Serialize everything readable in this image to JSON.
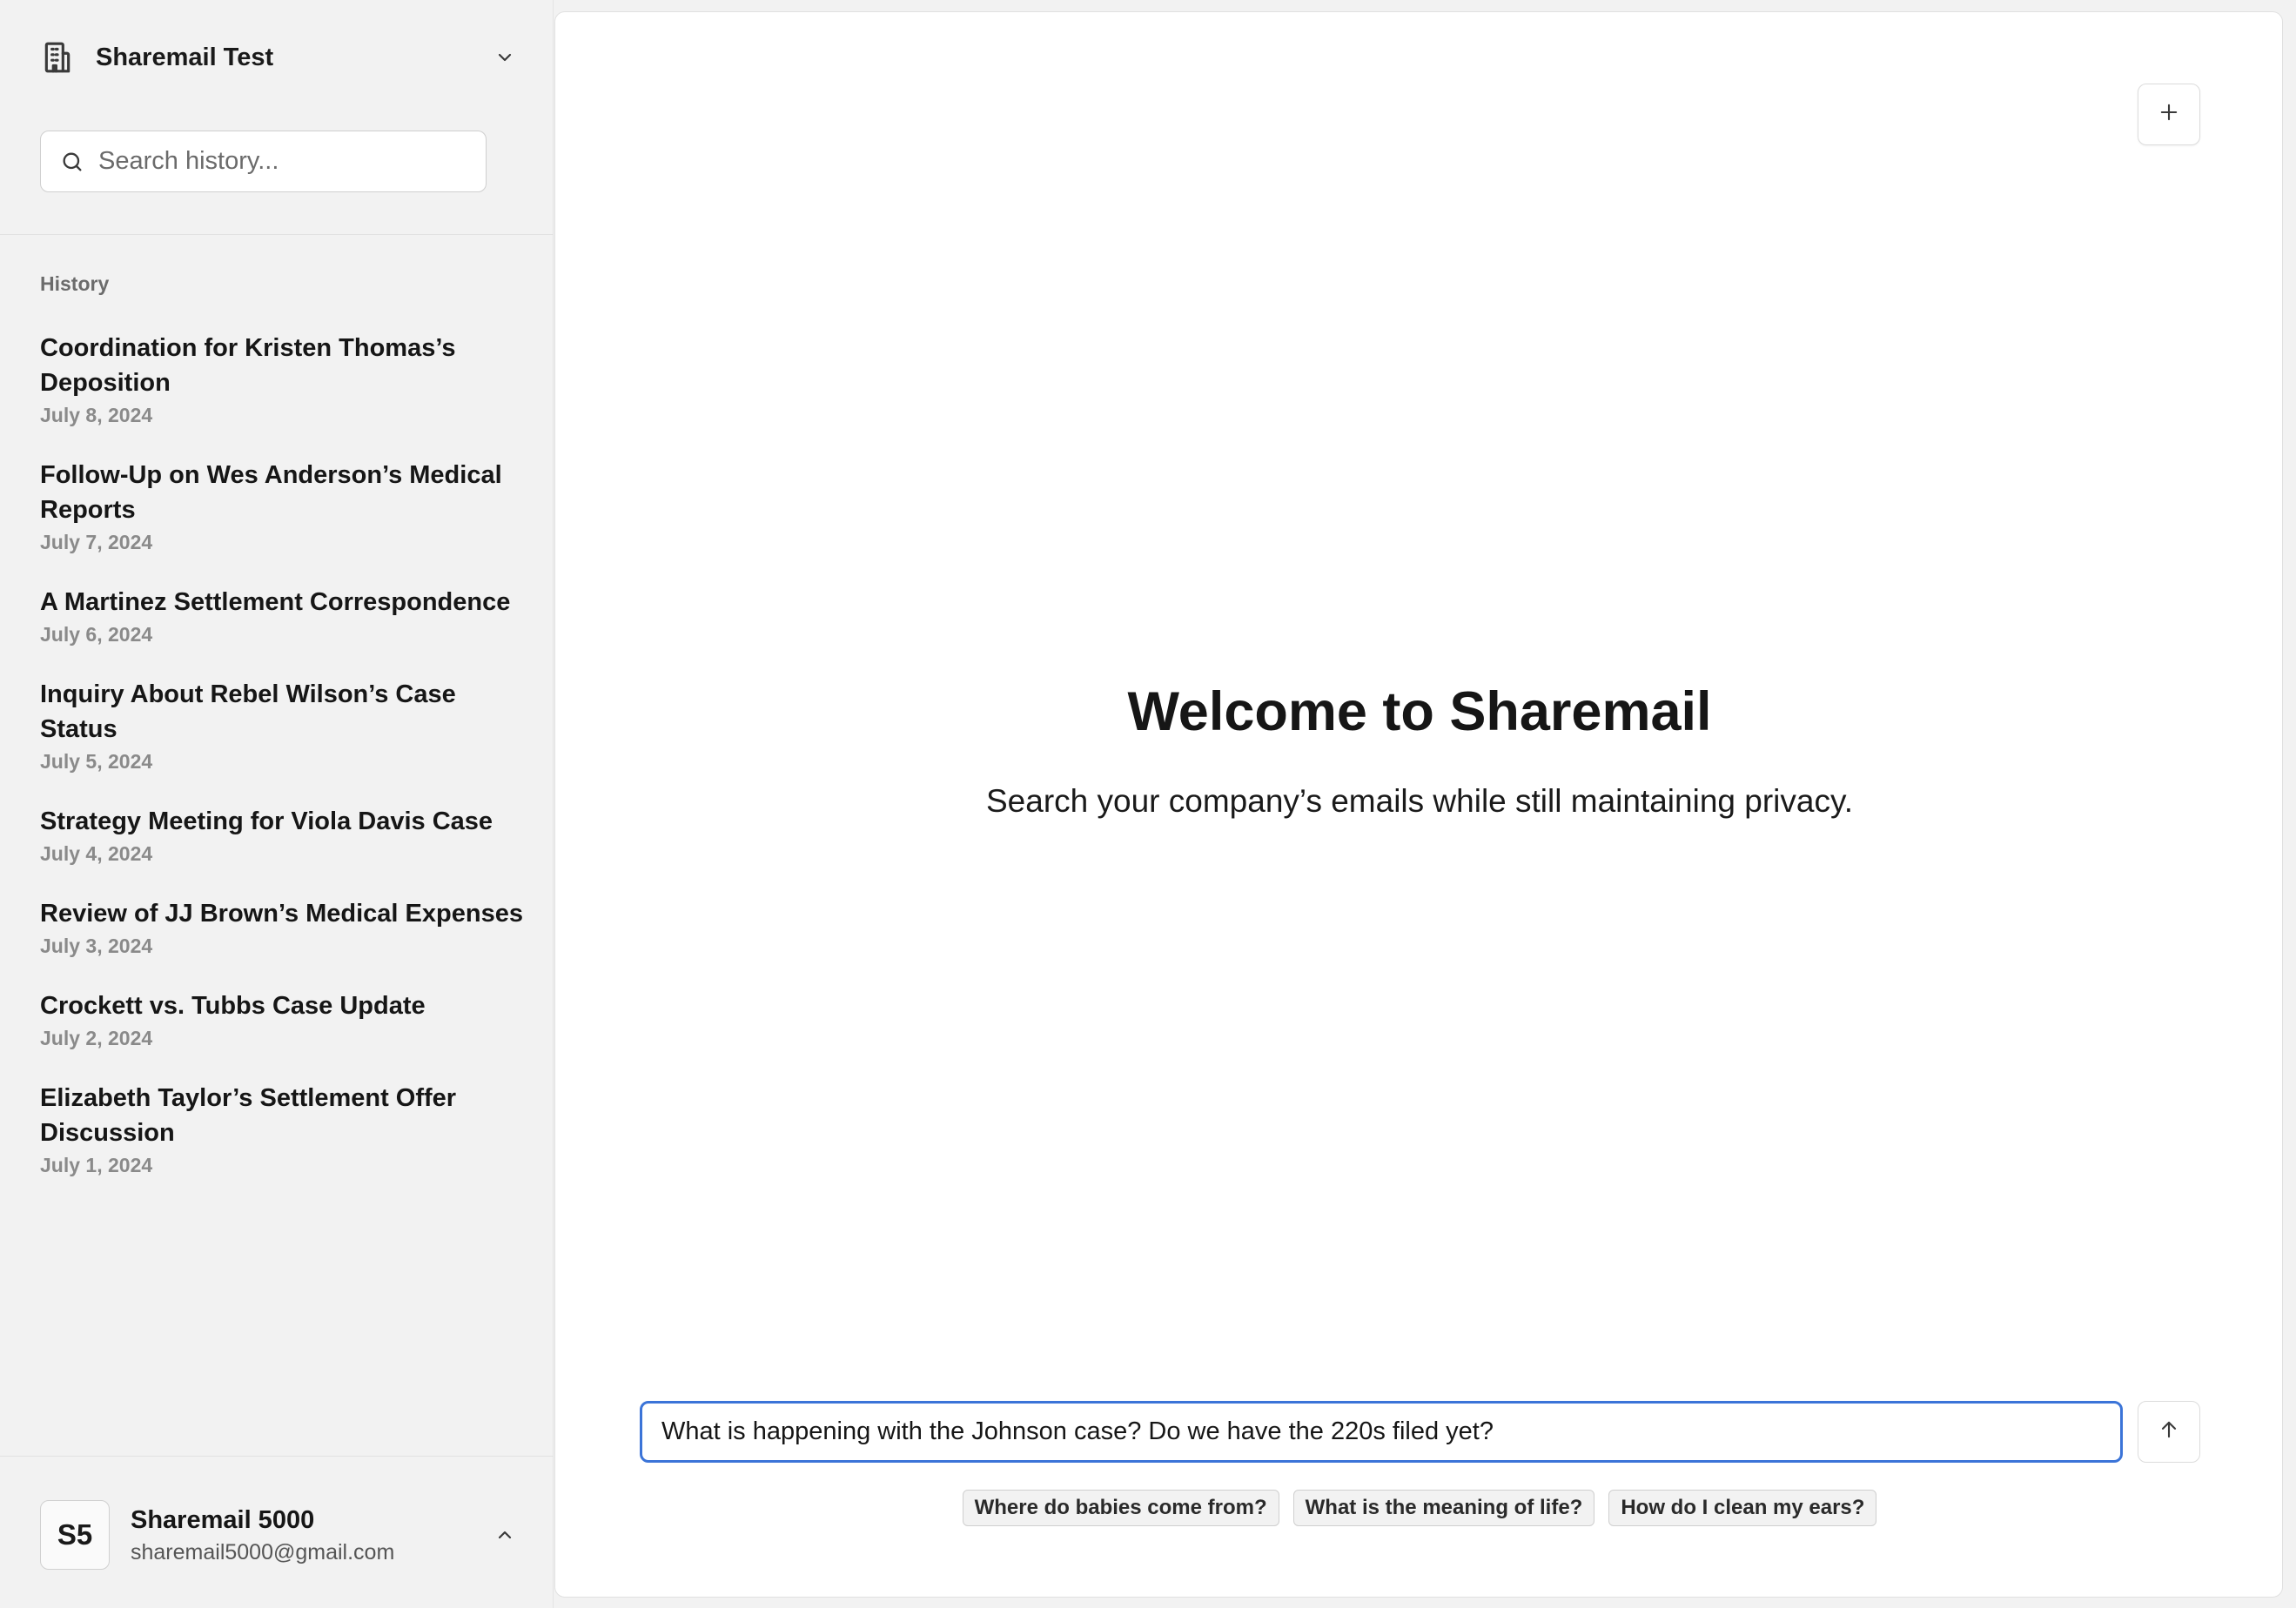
{
  "workspace": {
    "name": "Sharemail Test",
    "icon": "building-icon"
  },
  "search": {
    "placeholder": "Search history..."
  },
  "history": {
    "label": "History",
    "items": [
      {
        "title": "Coordination for Kristen Thomas’s Deposition",
        "date": "July 8, 2024"
      },
      {
        "title": "Follow-Up on Wes Anderson’s Medical Reports",
        "date": "July 7, 2024"
      },
      {
        "title": "A Martinez Settlement Correspondence",
        "date": "July 6, 2024"
      },
      {
        "title": "Inquiry About Rebel Wilson’s Case Status",
        "date": "July 5, 2024"
      },
      {
        "title": "Strategy Meeting for Viola Davis Case",
        "date": "July 4, 2024"
      },
      {
        "title": "Review of JJ Brown’s Medical Expenses",
        "date": "July 3, 2024"
      },
      {
        "title": "Crockett vs. Tubbs Case Update",
        "date": "July 2, 2024"
      },
      {
        "title": "Elizabeth Taylor’s Settlement Offer Discussion",
        "date": "July 1, 2024"
      }
    ]
  },
  "user": {
    "initials": "S5",
    "name": "Sharemail 5000",
    "email": "sharemail5000@gmail.com"
  },
  "main": {
    "title": "Welcome to Sharemail",
    "subtitle": "Search your company’s emails while still maintaining privacy.",
    "input_value": "What is happening with the Johnson case? Do we have the 220s filed yet?",
    "suggestions": [
      "Where do babies come from?",
      "What is the meaning of life?",
      "How do I clean my ears?"
    ]
  },
  "colors": {
    "accent": "#3b74d8",
    "sidebar_bg": "#f2f2f2",
    "main_bg": "#ffffff"
  }
}
